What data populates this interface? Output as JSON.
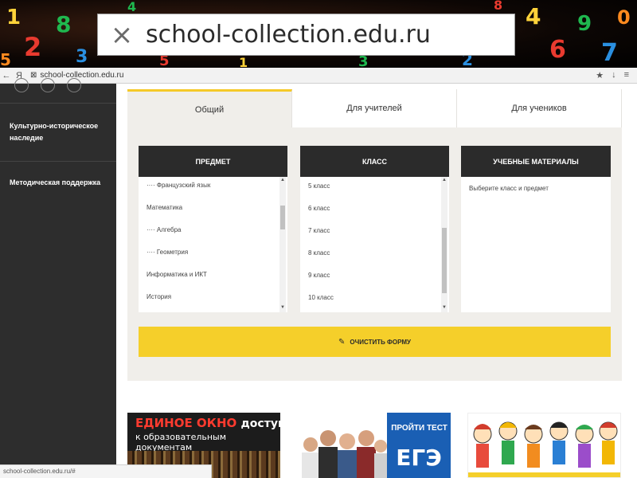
{
  "overlay": {
    "close_glyph": "×",
    "url_text": "school-collection.edu.ru"
  },
  "browser": {
    "back": "←",
    "yandex": "Я",
    "page_glyph": "⊠",
    "address": "school-collection.edu.ru",
    "star": "★",
    "download": "↓",
    "menu": "≡"
  },
  "sidebar": {
    "items": [
      {
        "label": "Культурно-историческое наследие"
      },
      {
        "label": "Методическая поддержка"
      }
    ]
  },
  "tabs": [
    {
      "label": "Общий"
    },
    {
      "label": "Для учителей"
    },
    {
      "label": "Для учеников"
    }
  ],
  "columns": {
    "subject": {
      "header": "ПРЕДМЕТ",
      "items": [
        "···· Французский язык",
        "Математика",
        "···· Алгебра",
        "···· Геометрия",
        "Информатика и ИКТ",
        "История"
      ]
    },
    "class": {
      "header": "КЛАСС",
      "items": [
        "5 класс",
        "6 класс",
        "7 класс",
        "8 класс",
        "9 класс",
        "10 класс"
      ]
    },
    "materials": {
      "header": "УЧЕБНЫЕ МАТЕРИАЛЫ",
      "message": "Выберите класс и предмет"
    }
  },
  "clear_button": {
    "icon": "✎",
    "label": "ОЧИСТИТЬ ФОРМУ"
  },
  "promos": {
    "window": {
      "line1_red": "ЕДИНОЕ ОКНО",
      "line1_white": "доступа",
      "line2": "к образовательным документам"
    },
    "ege": {
      "line1": "ПРОЙТИ ТЕСТ",
      "line2": "ЕГЭ"
    }
  },
  "status": {
    "text": "school-collection.edu.ru/#"
  },
  "colors": {
    "accent": "#f5c928",
    "dark": "#2b2b2b",
    "sidebar": "#2d2d2d",
    "panel": "#f0eeea"
  }
}
